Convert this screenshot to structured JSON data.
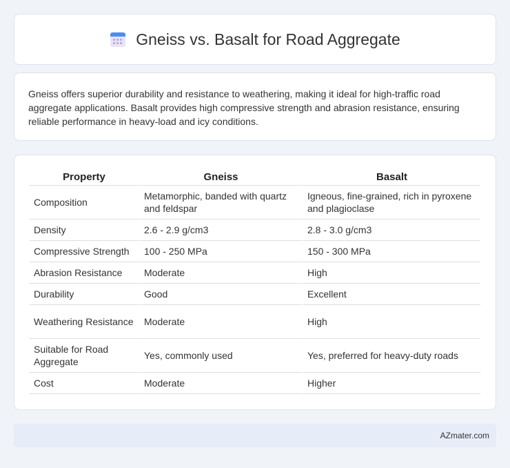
{
  "header": {
    "title": "Gneiss vs. Basalt for Road Aggregate",
    "icon": "calendar-icon",
    "icon_color": "#4b8df0"
  },
  "intro": {
    "text": "Gneiss offers superior durability and resistance to weathering, making it ideal for high-traffic road aggregate applications. Basalt provides high compressive strength and abrasion resistance, ensuring reliable performance in heavy-load and icy conditions."
  },
  "table": {
    "headers": [
      "Property",
      "Gneiss",
      "Basalt"
    ],
    "rows": [
      [
        "Composition",
        "Metamorphic, banded with quartz and feldspar",
        "Igneous, fine-grained, rich in pyroxene and plagioclase"
      ],
      [
        "Density",
        "2.6 - 2.9 g/cm3",
        "2.8 - 3.0 g/cm3"
      ],
      [
        "Compressive Strength",
        "100 - 250 MPa",
        "150 - 300 MPa"
      ],
      [
        "Abrasion Resistance",
        "Moderate",
        "High"
      ],
      [
        "Durability",
        "Good",
        "Excellent"
      ],
      [
        "Weathering Resistance",
        "Moderate",
        "High"
      ],
      [
        "Suitable for Road Aggregate",
        "Yes, commonly used",
        "Yes, preferred for heavy-duty roads"
      ],
      [
        "Cost",
        "Moderate",
        "Higher"
      ]
    ]
  },
  "footer": {
    "brand": "AZmater.com"
  }
}
